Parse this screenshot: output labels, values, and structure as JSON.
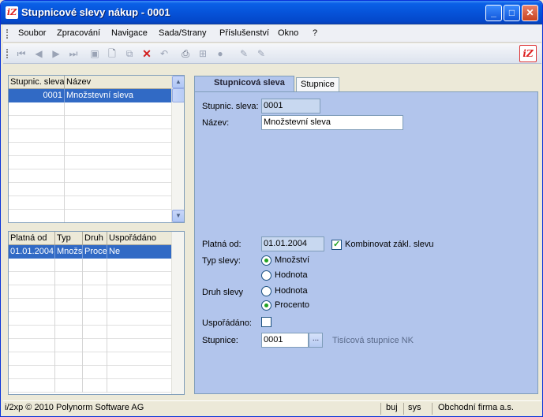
{
  "window": {
    "title": "Stupnicové slevy nákup - 0001",
    "app_icon": "iZ",
    "minimize": "_",
    "maximize": "□",
    "close": "✕"
  },
  "menu": [
    "Soubor",
    "Zpracování",
    "Navigace",
    "Sada/Strany",
    "Příslušenství",
    "Okno",
    "?"
  ],
  "toolbar": {
    "icons": [
      "first-icon",
      "prev-icon",
      "next-icon",
      "last-icon",
      "save-icon",
      "new-icon",
      "copy-icon",
      "delete-icon",
      "undo-icon",
      "print-icon",
      "tree-icon",
      "record-icon",
      "edit-icon",
      "edit2-icon"
    ],
    "logo": "iZ"
  },
  "grid_top": {
    "headers": [
      "Stupnic. sleva",
      "Název"
    ],
    "rows": [
      [
        "0001",
        "Množstevní sleva"
      ]
    ]
  },
  "grid_bottom": {
    "headers": [
      "Platná od",
      "Typ",
      "Druh",
      "Uspořádáno"
    ],
    "rows": [
      [
        "01.01.2004",
        "Množs",
        "Proce",
        "Ne"
      ]
    ]
  },
  "tabs": [
    "Stupnicová sleva",
    "Stupnice"
  ],
  "form": {
    "stupnic_label": "Stupnic. sleva:",
    "stupnic_value": "0001",
    "nazev_label": "Název:",
    "nazev_value": "Množstevní sleva",
    "platna_label": "Platná od:",
    "platna_value": "01.01.2004",
    "kombinovat_label": "Kombinovat zákl. slevu",
    "kombinovat_checked": true,
    "typ_label": "Typ slevy:",
    "typ_options": [
      "Množství",
      "Hodnota"
    ],
    "typ_selected": "Množství",
    "druh_label": "Druh slevy",
    "druh_options": [
      "Hodnota",
      "Procento"
    ],
    "druh_selected": "Procento",
    "usporadano_label": "Uspořádáno:",
    "usporadano_checked": false,
    "stupnice_label": "Stupnice:",
    "stupnice_value": "0001",
    "stupnice_button": "...",
    "stupnice_desc": "Tisícová stupnice NK"
  },
  "status": {
    "copyright": "i/2xp © 2010 Polynorm Software AG",
    "user": "buj",
    "system": "sys",
    "company": "Obchodní firma a.s."
  }
}
